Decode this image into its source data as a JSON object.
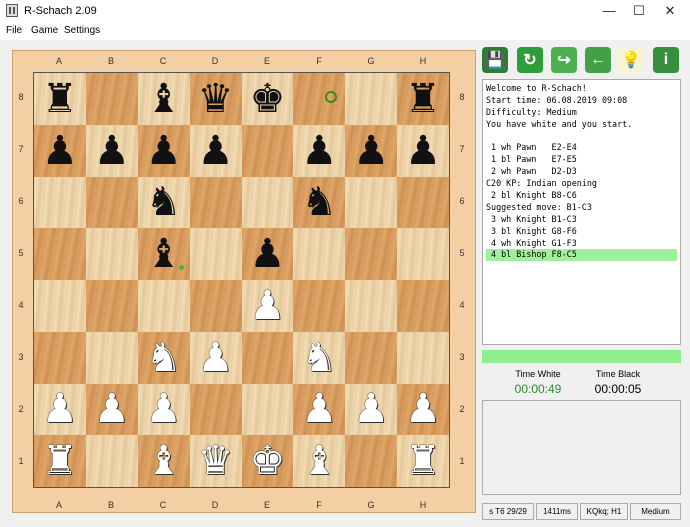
{
  "window": {
    "title": "R-Schach 2.09",
    "controls": [
      "—",
      "☐",
      "✕"
    ]
  },
  "menu": [
    "File",
    "Game",
    "Settings"
  ],
  "board": {
    "files": [
      "A",
      "B",
      "C",
      "D",
      "E",
      "F",
      "G",
      "H"
    ],
    "ranks": [
      "8",
      "7",
      "6",
      "5",
      "4",
      "3",
      "2",
      "1"
    ],
    "rows": [
      [
        "br",
        "",
        "bb",
        "bq",
        "bk",
        "",
        "",
        "br"
      ],
      [
        "bp",
        "bp",
        "bp",
        "bp",
        "",
        "bp",
        "bp",
        "bp"
      ],
      [
        "",
        "",
        "bn",
        "",
        "",
        "bn",
        "",
        ""
      ],
      [
        "",
        "",
        "bb",
        "",
        "bp",
        "",
        "",
        ""
      ],
      [
        "",
        "",
        "",
        "",
        "wp",
        "",
        "",
        ""
      ],
      [
        "",
        "",
        "wn",
        "wp",
        "",
        "wn",
        "",
        ""
      ],
      [
        "wp",
        "wp",
        "wp",
        "",
        "",
        "wp",
        "wp",
        "wp"
      ],
      [
        "wr",
        "",
        "wb",
        "wq",
        "wk",
        "wb",
        "",
        "wr"
      ]
    ],
    "glyphs": {
      "k": "♚",
      "q": "♛",
      "r": "♜",
      "b": "♝",
      "n": "♞",
      "p": "♟"
    }
  },
  "toolbar": [
    {
      "name": "save-icon",
      "glyph": "💾",
      "bg": "#2e7d32"
    },
    {
      "name": "new-game-icon",
      "glyph": "↻",
      "bg": "#2e9e3a"
    },
    {
      "name": "redo-icon",
      "glyph": "↪",
      "bg": "#4caf50"
    },
    {
      "name": "back-icon",
      "glyph": "←",
      "bg": "#43a047"
    },
    {
      "name": "hint-bulb-icon",
      "glyph": "💡",
      "bg": "#f7f3d6"
    },
    {
      "name": "info-icon",
      "glyph": "i",
      "bg": "#388e3c"
    }
  ],
  "log": [
    "Welcome to R-Schach!",
    "Start time: 06.08.2019 09:08",
    "Difficulty: Medium",
    "You have white and you start.",
    "",
    " 1 wh Pawn   E2-E4",
    " 1 bl Pawn   E7-E5",
    " 2 wh Pawn   D2-D3",
    "C20 KP: Indian opening",
    " 2 bl Knight B8-C6",
    "Suggested move: B1-C3",
    " 3 wh Knight B1-C3",
    " 3 bl Knight G8-F6",
    " 4 wh Knight G1-F3",
    " 4 bl Bishop F8-C5"
  ],
  "log_selected_index": 14,
  "times": {
    "white_label": "Time White",
    "white_value": "00:00:49",
    "black_label": "Time Black",
    "black_value": "00:00:05",
    "white_color": "#2e8b2e"
  },
  "status": [
    "s T6 29/29",
    "1411ms",
    "KQkq; H1",
    "Medium"
  ]
}
